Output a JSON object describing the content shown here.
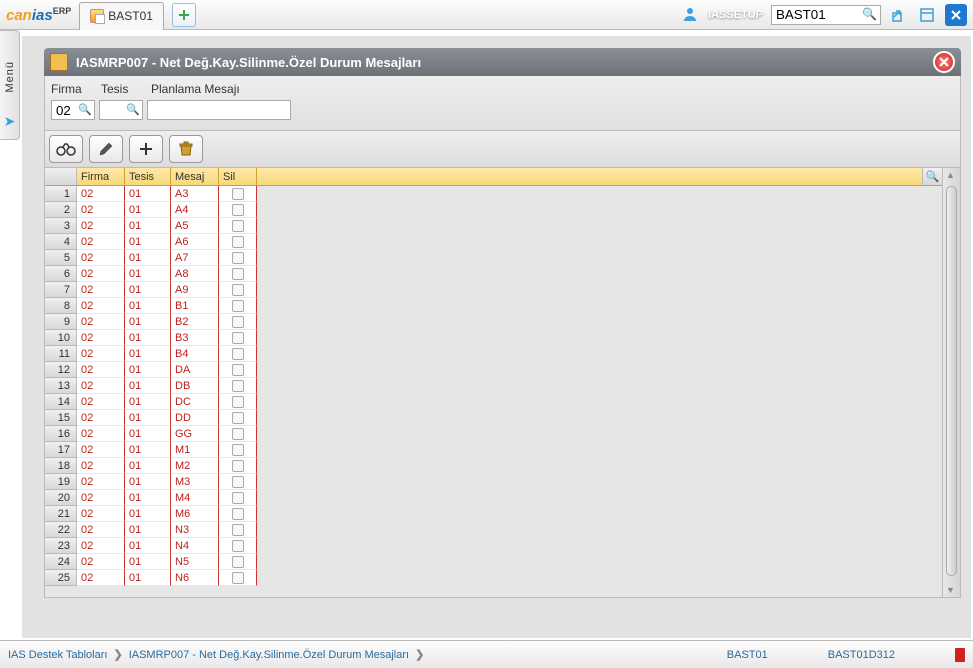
{
  "app": {
    "logo_1": "can",
    "logo_2": "ias",
    "logo_sup": "ERP"
  },
  "top": {
    "tab_label": "BAST01",
    "user": "IASSETUP",
    "search_value": "BAST01"
  },
  "leftmenu": {
    "label": "Menü"
  },
  "panel": {
    "title": "IASMRP007 - Net Değ.Kay.Silinme.Özel Durum Mesajları"
  },
  "filters": {
    "firma_label": "Firma",
    "tesis_label": "Tesis",
    "planlama_label": "Planlama Mesajı",
    "firma_value": "02",
    "tesis_value": "",
    "planlama_value": ""
  },
  "columns": {
    "firma": "Firma",
    "tesis": "Tesis",
    "mesaj": "Mesaj",
    "sil": "Sil"
  },
  "rows": [
    {
      "n": "1",
      "firma": "02",
      "tesis": "01",
      "mesaj": "A3"
    },
    {
      "n": "2",
      "firma": "02",
      "tesis": "01",
      "mesaj": "A4"
    },
    {
      "n": "3",
      "firma": "02",
      "tesis": "01",
      "mesaj": "A5"
    },
    {
      "n": "4",
      "firma": "02",
      "tesis": "01",
      "mesaj": "A6"
    },
    {
      "n": "5",
      "firma": "02",
      "tesis": "01",
      "mesaj": "A7"
    },
    {
      "n": "6",
      "firma": "02",
      "tesis": "01",
      "mesaj": "A8"
    },
    {
      "n": "7",
      "firma": "02",
      "tesis": "01",
      "mesaj": "A9"
    },
    {
      "n": "8",
      "firma": "02",
      "tesis": "01",
      "mesaj": "B1"
    },
    {
      "n": "9",
      "firma": "02",
      "tesis": "01",
      "mesaj": "B2"
    },
    {
      "n": "10",
      "firma": "02",
      "tesis": "01",
      "mesaj": "B3"
    },
    {
      "n": "11",
      "firma": "02",
      "tesis": "01",
      "mesaj": "B4"
    },
    {
      "n": "12",
      "firma": "02",
      "tesis": "01",
      "mesaj": "DA"
    },
    {
      "n": "13",
      "firma": "02",
      "tesis": "01",
      "mesaj": "DB"
    },
    {
      "n": "14",
      "firma": "02",
      "tesis": "01",
      "mesaj": "DC"
    },
    {
      "n": "15",
      "firma": "02",
      "tesis": "01",
      "mesaj": "DD"
    },
    {
      "n": "16",
      "firma": "02",
      "tesis": "01",
      "mesaj": "GG"
    },
    {
      "n": "17",
      "firma": "02",
      "tesis": "01",
      "mesaj": "M1"
    },
    {
      "n": "18",
      "firma": "02",
      "tesis": "01",
      "mesaj": "M2"
    },
    {
      "n": "19",
      "firma": "02",
      "tesis": "01",
      "mesaj": "M3"
    },
    {
      "n": "20",
      "firma": "02",
      "tesis": "01",
      "mesaj": "M4"
    },
    {
      "n": "21",
      "firma": "02",
      "tesis": "01",
      "mesaj": "M6"
    },
    {
      "n": "22",
      "firma": "02",
      "tesis": "01",
      "mesaj": "N3"
    },
    {
      "n": "23",
      "firma": "02",
      "tesis": "01",
      "mesaj": "N4"
    },
    {
      "n": "24",
      "firma": "02",
      "tesis": "01",
      "mesaj": "N5"
    },
    {
      "n": "25",
      "firma": "02",
      "tesis": "01",
      "mesaj": "N6"
    }
  ],
  "status": {
    "crumb1": "IAS Destek Tabloları",
    "crumb2": "IASMRP007 - Net Değ.Kay.Silinme.Özel Durum Mesajları",
    "code1": "BAST01",
    "code2": "BAST01D312"
  }
}
